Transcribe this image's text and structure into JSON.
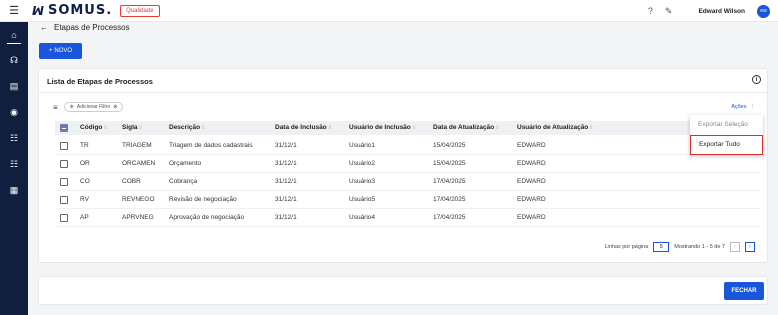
{
  "app": {
    "logo_mark": "ꟽ",
    "logo": "SOMUS.",
    "env_badge": "Qualidade"
  },
  "header": {
    "username": "Edward Wilson",
    "avatar_initials": "ew",
    "help_icon": "?",
    "notes_icon": "✎"
  },
  "sidebar": {
    "icons": [
      "home-icon",
      "users-icon",
      "id-card-icon",
      "target-icon",
      "list-check-icon",
      "list-check-icon",
      "grid-icon"
    ]
  },
  "breadcrumb": {
    "back": "←",
    "title": "Etapas de Processos"
  },
  "toolbar": {
    "new_label": "NOVO",
    "new_icon": "+"
  },
  "card": {
    "title": "Lista de Etapas de Processos",
    "info": "i"
  },
  "filters": {
    "chip_label": "Adicionar Filtro",
    "actions_label": "Ações"
  },
  "table": {
    "columns": [
      "Código",
      "Sigla",
      "Descrição",
      "Data de Inclusão",
      "Usuário de Inclusão",
      "Data de Atualização",
      "Usuário de Atualização"
    ],
    "rows": [
      {
        "codigo": "TR",
        "sigla": "TRIAGEM",
        "descricao": "Triagem de dados cadastrais",
        "data_inclusao": "31/12/1",
        "usuario_inclusao": "Usuário1",
        "data_atualizacao": "15/04/2025",
        "usuario_atualizacao": "EDWARD"
      },
      {
        "codigo": "OR",
        "sigla": "ORCAMEN",
        "descricao": "Orçamento",
        "data_inclusao": "31/12/1",
        "usuario_inclusao": "Usuário2",
        "data_atualizacao": "15/04/2025",
        "usuario_atualizacao": "EDWARD"
      },
      {
        "codigo": "CO",
        "sigla": "COBR",
        "descricao": "Cobrança",
        "data_inclusao": "31/12/1",
        "usuario_inclusao": "Usuário3",
        "data_atualizacao": "17/04/2025",
        "usuario_atualizacao": "EDWARD"
      },
      {
        "codigo": "RV",
        "sigla": "REVNEGO",
        "descricao": "Revisão de negociação",
        "data_inclusao": "31/12/1",
        "usuario_inclusao": "Usuário5",
        "data_atualizacao": "17/04/2025",
        "usuario_atualizacao": "EDWARD"
      },
      {
        "codigo": "AP",
        "sigla": "APRVNEG",
        "descricao": "Aprovação de negociação",
        "data_inclusao": "31/12/1",
        "usuario_inclusao": "Usuário4",
        "data_atualizacao": "17/04/2025",
        "usuario_atualizacao": "EDWARD"
      }
    ]
  },
  "menu": {
    "export_selection": "Exportar Seleção",
    "export_all": "Exportar Tudo"
  },
  "pagination": {
    "rows_label": "Linhas por página",
    "rows_value": "5",
    "showing": "Mostrando 1 - 5 de 7",
    "prev": "‹",
    "next": "›"
  },
  "footer": {
    "close_label": "FECHAR"
  }
}
